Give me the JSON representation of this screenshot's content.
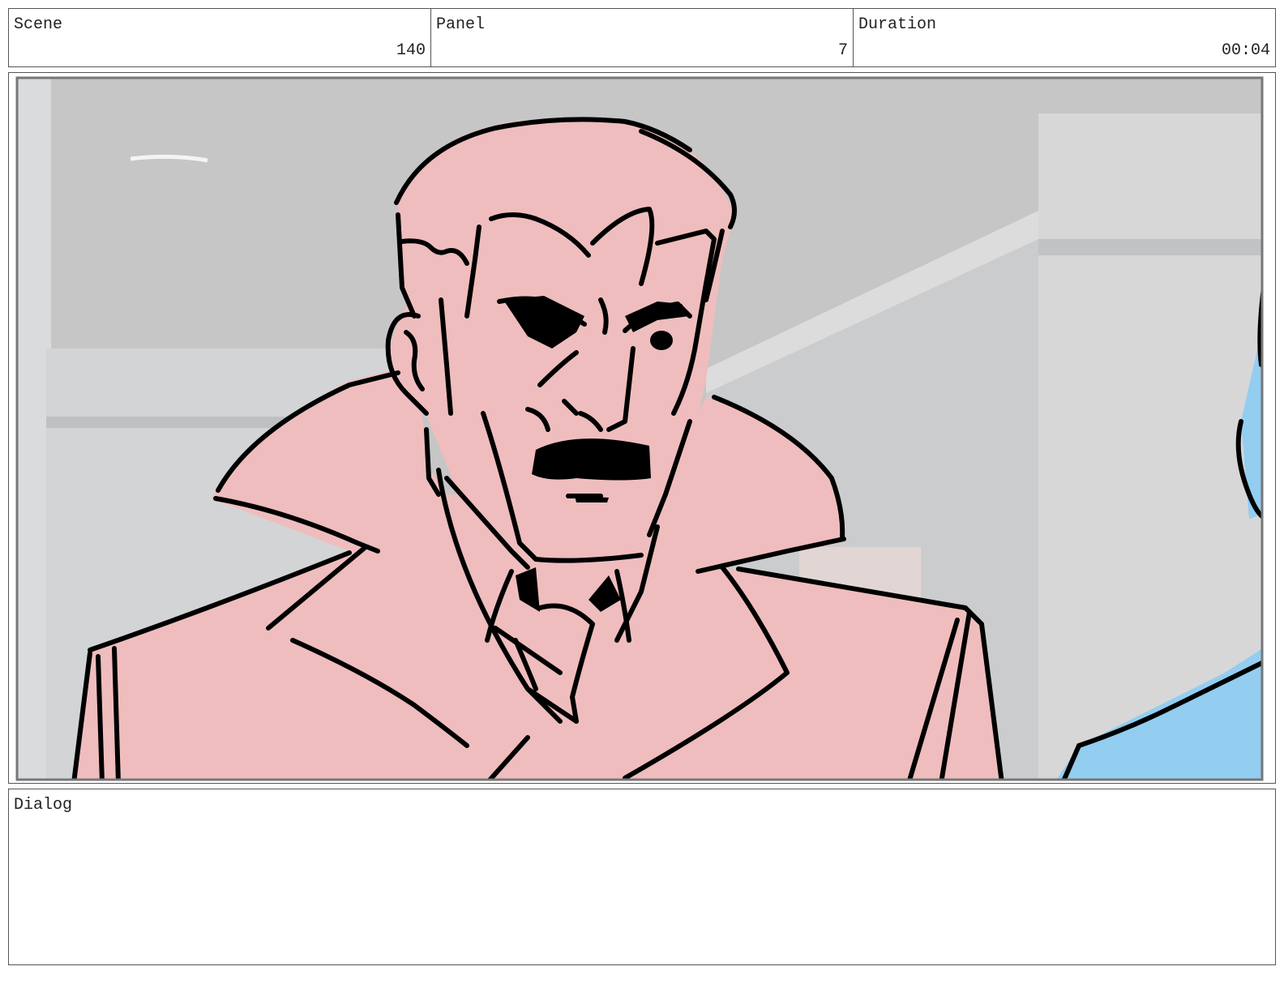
{
  "header": {
    "scene_label": "Scene",
    "scene_value": "140",
    "panel_label": "Panel",
    "panel_value": "7",
    "duration_label": "Duration",
    "duration_value": "00:04"
  },
  "dialog": {
    "label": "Dialog",
    "text": ""
  },
  "colors": {
    "character_fill": "#efbdbd",
    "background": "#c5c6c5",
    "secondary_character": "#93cdf0",
    "linework": "#000000"
  }
}
